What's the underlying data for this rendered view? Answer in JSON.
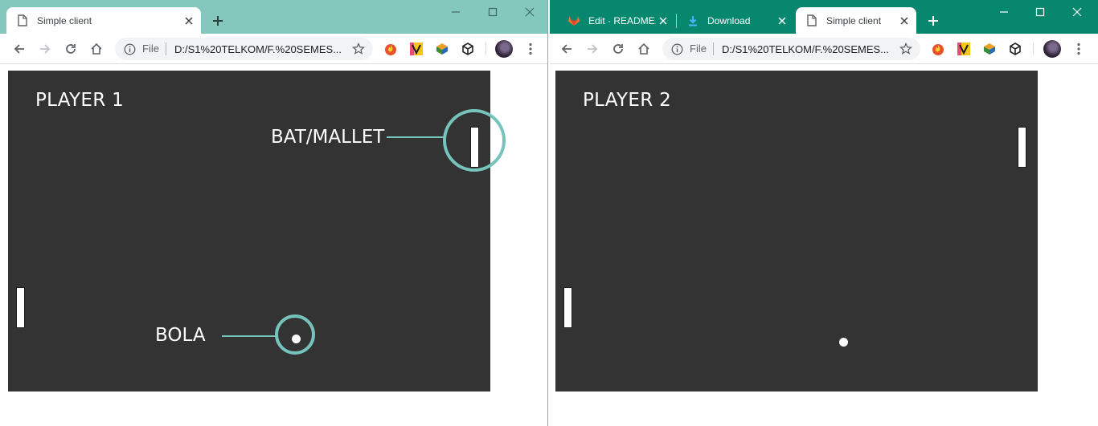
{
  "windows": {
    "left": {
      "tabs": [
        {
          "label": "Simple client",
          "favicon": "page-icon",
          "active": true
        }
      ],
      "url": "D:/S1%20TELKOM/F.%20SEMES...",
      "file_label": "File",
      "game": {
        "player_label": "PLAYER 1",
        "annotations": {
          "paddle_label": "BAT/MALLET",
          "ball_label": "BOLA",
          "color": "#76c3bb"
        }
      }
    },
    "right": {
      "tabs": [
        {
          "label": "Edit · README.md",
          "favicon": "gitlab-icon",
          "active": false
        },
        {
          "label": "Download",
          "favicon": "download-icon",
          "active": false
        },
        {
          "label": "Simple client",
          "favicon": "page-icon",
          "active": true
        }
      ],
      "url": "D:/S1%20TELKOM/F.%20SEMES...",
      "file_label": "File",
      "game": {
        "player_label": "PLAYER 2"
      }
    }
  },
  "colors": {
    "left_frame": "#84c8bd",
    "right_frame": "#08876f",
    "game_bg": "#333333"
  }
}
